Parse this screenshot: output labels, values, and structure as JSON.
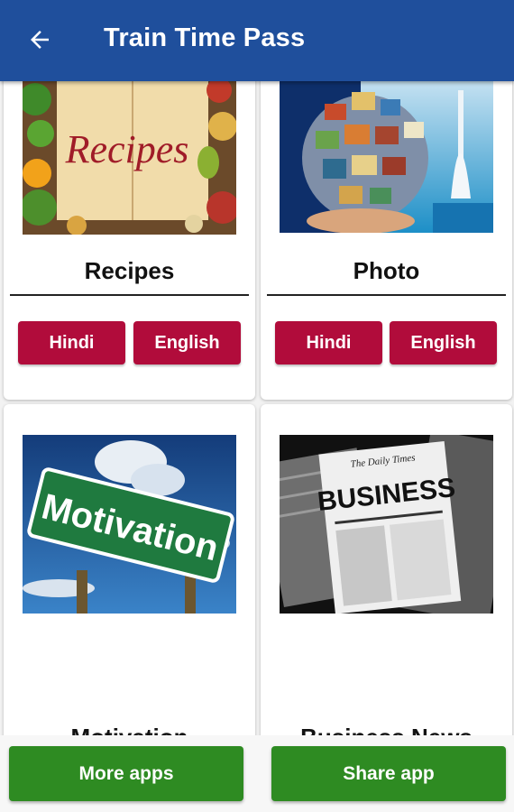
{
  "appbar": {
    "title": "Train Time Pass",
    "back_icon": "arrow-back-icon"
  },
  "cards": [
    {
      "label": "Recipes",
      "image_text": "Recipes",
      "buttons": [
        "Hindi",
        "English"
      ]
    },
    {
      "label": "Photo",
      "image_text": "",
      "buttons": [
        "Hindi",
        "English"
      ]
    },
    {
      "label": "Motivation",
      "image_text": "Motivation"
    },
    {
      "label": "Business News",
      "image_text": "BUSINESS",
      "masthead": "The Daily Times"
    }
  ],
  "bottom": {
    "more_apps": "More apps",
    "share_app": "Share app"
  },
  "colors": {
    "appbar": "#1f4f9c",
    "lang_button": "#b10c3b",
    "action_button": "#2e8b22"
  }
}
